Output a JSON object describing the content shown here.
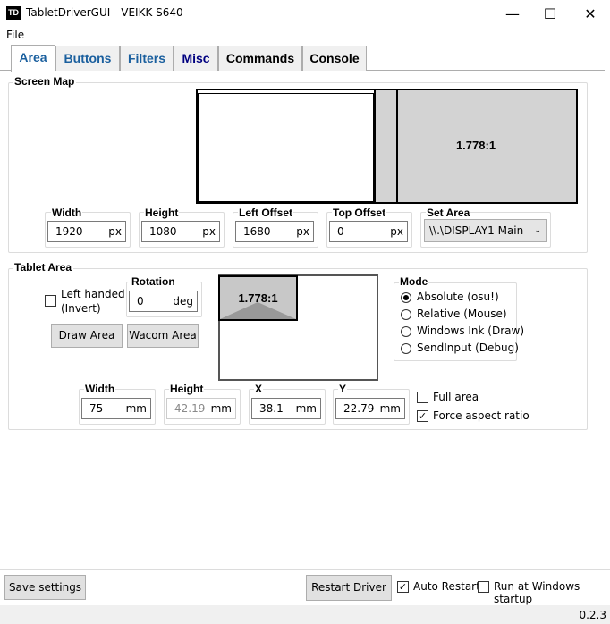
{
  "window": {
    "title": "TabletDriverGUI - VEIKK S640",
    "icon_text": "TD",
    "minimize_glyph": "—",
    "maximize_glyph": "☐",
    "close_glyph": "✕"
  },
  "menu": {
    "file": "File"
  },
  "tabs": [
    "Area",
    "Buttons",
    "Filters",
    "Misc",
    "Commands",
    "Console"
  ],
  "screen_map": {
    "group_label": "Screen Map",
    "ratio": "1.778:1",
    "width": {
      "label": "Width",
      "value": "1920",
      "unit": "px"
    },
    "height": {
      "label": "Height",
      "value": "1080",
      "unit": "px"
    },
    "left_offset": {
      "label": "Left Offset",
      "value": "1680",
      "unit": "px"
    },
    "top_offset": {
      "label": "Top Offset",
      "value": "0",
      "unit": "px"
    },
    "set_area": {
      "label": "Set Area",
      "value": "\\\\.\\DISPLAY1 Main"
    }
  },
  "tablet_area": {
    "group_label": "Tablet Area",
    "left_handed": "Left handed\n(Invert)",
    "left_handed_line1": "Left handed",
    "left_handed_line2": "(Invert)",
    "rotation": {
      "label": "Rotation",
      "value": "0",
      "unit": "deg"
    },
    "draw_area": "Draw Area",
    "wacom_area": "Wacom Area",
    "ratio": "1.778:1",
    "mode": {
      "label": "Mode",
      "options": [
        "Absolute (osu!)",
        "Relative (Mouse)",
        "Windows Ink (Draw)",
        "SendInput (Debug)"
      ],
      "selected": "Absolute (osu!)"
    },
    "width": {
      "label": "Width",
      "value": "75",
      "unit": "mm"
    },
    "height": {
      "label": "Height",
      "value": "42.19",
      "unit": "mm"
    },
    "x": {
      "label": "X",
      "value": "38.1",
      "unit": "mm"
    },
    "y": {
      "label": "Y",
      "value": "22.79",
      "unit": "mm"
    },
    "full_area": "Full area",
    "force_aspect": "Force aspect ratio"
  },
  "bottom": {
    "save_settings": "Save settings",
    "restart_driver": "Restart Driver",
    "auto_restart": "Auto Restart",
    "run_at_startup": "Run at Windows startup"
  },
  "status": {
    "version": "0.2.3"
  }
}
